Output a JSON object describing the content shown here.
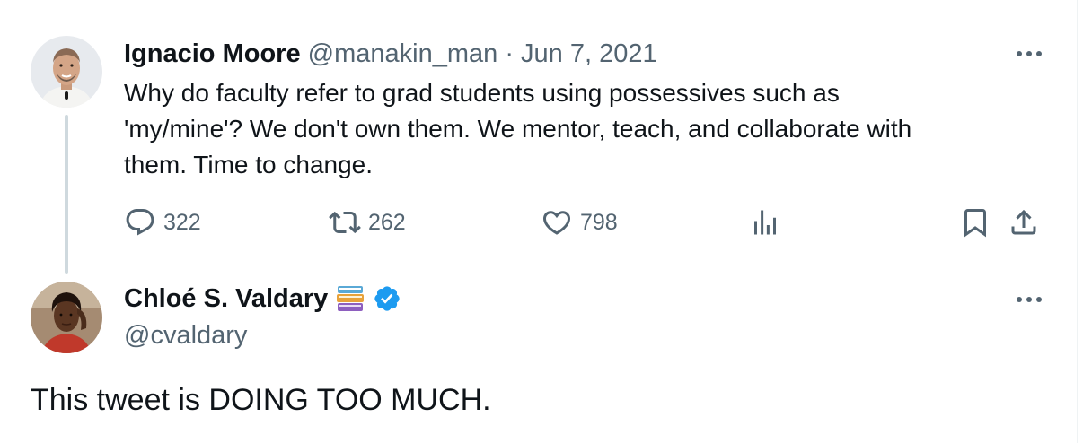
{
  "original_tweet": {
    "author_name": "Ignacio Moore",
    "handle": "@manakin_man",
    "separator": "·",
    "date": "Jun 7, 2021",
    "text": "Why do faculty refer to grad students using possessives such as\n'my/mine'? We don't own them. We mentor, teach, and collaborate with\nthem. Time to change.",
    "replies": "322",
    "retweets": "262",
    "likes": "798"
  },
  "quote_tweet": {
    "author_name": "Chloé S. Valdary",
    "handle": "@cvaldary",
    "badge_emoji": "books",
    "verified": true,
    "text": "This tweet is DOING TOO MUCH."
  },
  "colors": {
    "text_primary": "#0f1419",
    "text_secondary": "#536471",
    "thread_line": "#cfd9de",
    "verified_blue": "#1d9bf0"
  },
  "icons": {
    "reply": "speech-bubble-icon",
    "retweet": "retweet-arrows-icon",
    "like": "heart-icon",
    "views": "bar-chart-icon",
    "bookmark": "bookmark-icon",
    "share": "share-upload-icon",
    "more": "three-dots-icon"
  }
}
